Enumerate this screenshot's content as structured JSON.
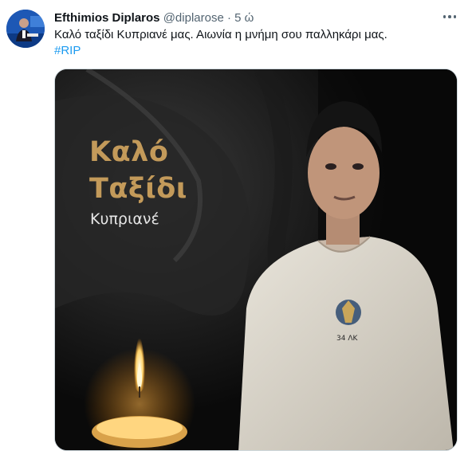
{
  "tweet": {
    "author_name": "Efthimios Diplaros",
    "handle": "@diplarose",
    "separator": "·",
    "time": "5 ώ",
    "text": "Καλό ταξίδι Κυπριανέ μας. Αιωνία η μνήμη σου παλληκάρι μας.",
    "hashtag": "#RIP"
  },
  "media": {
    "title_line1": "Καλό",
    "title_line2": "Ταξίδι",
    "subtitle": "Κυπριανέ",
    "shirt_badge": "34 ΛΚ"
  },
  "colors": {
    "name": "#0f1419",
    "secondary": "#536471",
    "link": "#1d9bf0",
    "title_gold": "#c39a5a"
  },
  "icons": {
    "more": "more-horizontal-icon"
  }
}
